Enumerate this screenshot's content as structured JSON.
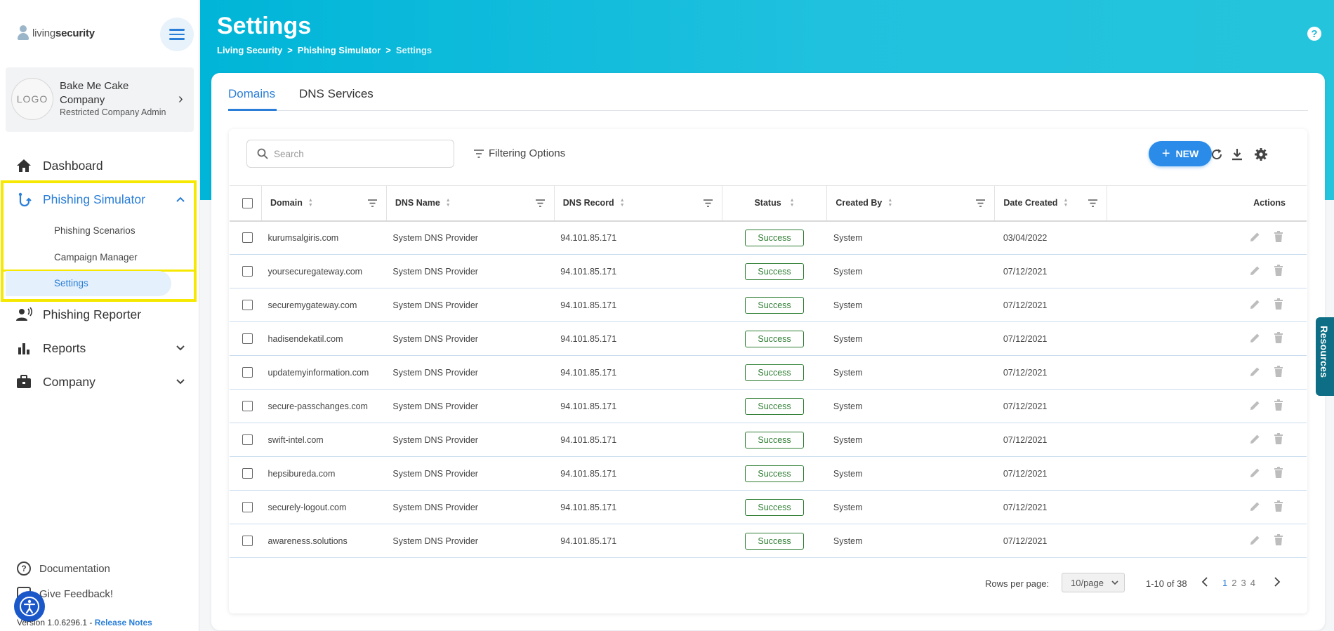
{
  "brand": {
    "logo_text_a": "living",
    "logo_text_b": "security"
  },
  "company": {
    "logo_placeholder": "LOGO",
    "name": "Bake Me Cake",
    "type": "Company",
    "role": "Restricted Company Admin"
  },
  "nav": {
    "dashboard": "Dashboard",
    "phishing_simulator": "Phishing Simulator",
    "phishing_scenarios": "Phishing Scenarios",
    "campaign_manager": "Campaign Manager",
    "settings": "Settings",
    "phishing_reporter": "Phishing Reporter",
    "reports": "Reports",
    "company": "Company"
  },
  "footer": {
    "documentation": "Documentation",
    "feedback": "Give Feedback!",
    "version_prefix": "Version 1.0.6296.1 - ",
    "release_notes": "Release Notes"
  },
  "header": {
    "title": "Settings",
    "breadcrumbs": [
      "Living Security",
      "Phishing Simulator",
      "Settings"
    ],
    "separator": ">"
  },
  "tabs": [
    "Domains",
    "DNS Services"
  ],
  "toolbar": {
    "search_placeholder": "Search",
    "filtering_options": "Filtering Options",
    "new_label": "NEW"
  },
  "table": {
    "columns": [
      "Domain",
      "DNS Name",
      "DNS Record",
      "Status",
      "Created By",
      "Date Created",
      "Actions"
    ],
    "rows": [
      {
        "domain": "kurumsalgiris.com",
        "dns_name": "System DNS Provider",
        "dns_record": "94.101.85.171",
        "status": "Success",
        "created_by": "System",
        "date": "03/04/2022"
      },
      {
        "domain": "yoursecuregateway.com",
        "dns_name": "System DNS Provider",
        "dns_record": "94.101.85.171",
        "status": "Success",
        "created_by": "System",
        "date": "07/12/2021"
      },
      {
        "domain": "securemygateway.com",
        "dns_name": "System DNS Provider",
        "dns_record": "94.101.85.171",
        "status": "Success",
        "created_by": "System",
        "date": "07/12/2021"
      },
      {
        "domain": "hadisendekatil.com",
        "dns_name": "System DNS Provider",
        "dns_record": "94.101.85.171",
        "status": "Success",
        "created_by": "System",
        "date": "07/12/2021"
      },
      {
        "domain": "updatemyinformation.com",
        "dns_name": "System DNS Provider",
        "dns_record": "94.101.85.171",
        "status": "Success",
        "created_by": "System",
        "date": "07/12/2021"
      },
      {
        "domain": "secure-passchanges.com",
        "dns_name": "System DNS Provider",
        "dns_record": "94.101.85.171",
        "status": "Success",
        "created_by": "System",
        "date": "07/12/2021"
      },
      {
        "domain": "swift-intel.com",
        "dns_name": "System DNS Provider",
        "dns_record": "94.101.85.171",
        "status": "Success",
        "created_by": "System",
        "date": "07/12/2021"
      },
      {
        "domain": "hepsibureda.com",
        "dns_name": "System DNS Provider",
        "dns_record": "94.101.85.171",
        "status": "Success",
        "created_by": "System",
        "date": "07/12/2021"
      },
      {
        "domain": "securely-logout.com",
        "dns_name": "System DNS Provider",
        "dns_record": "94.101.85.171",
        "status": "Success",
        "created_by": "System",
        "date": "07/12/2021"
      },
      {
        "domain": "awareness.solutions",
        "dns_name": "System DNS Provider",
        "dns_record": "94.101.85.171",
        "status": "Success",
        "created_by": "System",
        "date": "07/12/2021"
      }
    ]
  },
  "pagination": {
    "rows_per_page_label": "Rows per page:",
    "rows_per_page_value": "10/page",
    "range": "1-10 of 38",
    "pages": [
      "1",
      "2",
      "3",
      "4"
    ],
    "current_page": "1"
  },
  "resources_tab": "Resources",
  "colors": {
    "accent": "#2a7ed8",
    "header": "#1fc1de",
    "success": "#2e7d32",
    "highlight": "#f6e800"
  }
}
